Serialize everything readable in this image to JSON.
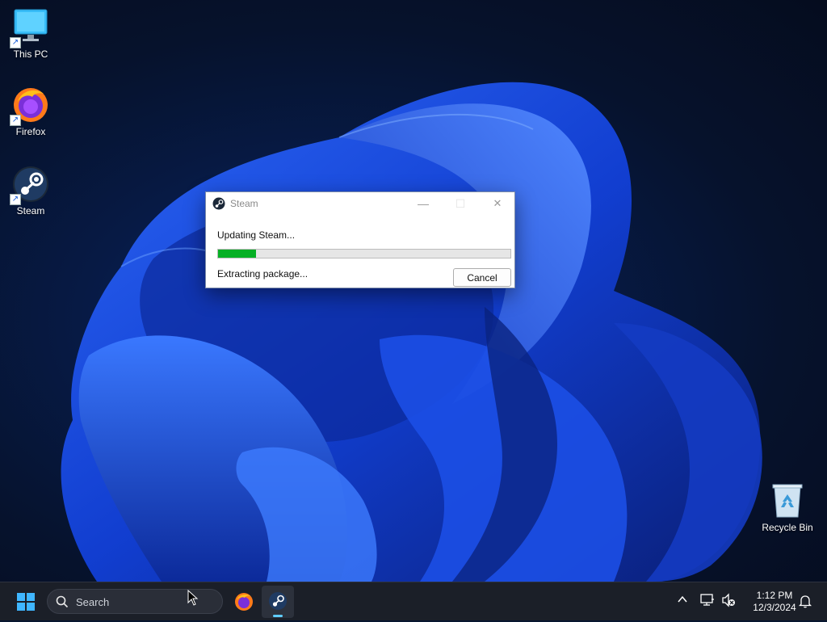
{
  "desktop": {
    "icons": [
      {
        "label": "This PC"
      },
      {
        "label": "Firefox"
      },
      {
        "label": "Steam"
      },
      {
        "label": "Recycle Bin"
      }
    ]
  },
  "dialog": {
    "title": "Steam",
    "status_line": "Updating Steam...",
    "progress_fraction": 0.13,
    "detail_line": "Extracting package...",
    "cancel_label": "Cancel",
    "minimize_glyph": "—",
    "maximize_glyph": "☐",
    "close_glyph": "✕"
  },
  "taskbar": {
    "search_placeholder": "Search",
    "pinned": [
      "firefox-icon",
      "steam-icon"
    ],
    "tray_icons": [
      "chevron-up-icon",
      "network-icon",
      "volume-muted-icon",
      "notification-bell-icon"
    ],
    "clock_time": "1:12 PM",
    "clock_date": "12/3/2024"
  },
  "colors": {
    "progress_green": "#06b025",
    "accent": "#0078d4"
  }
}
